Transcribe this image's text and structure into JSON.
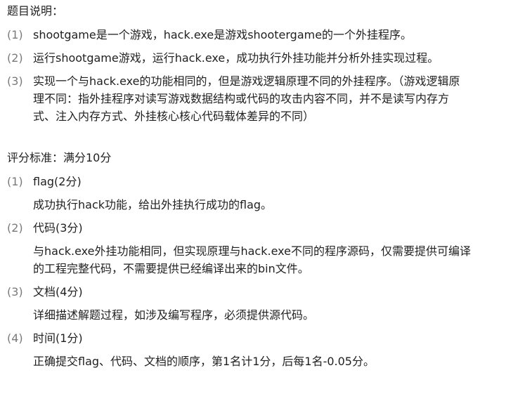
{
  "section1": {
    "heading": "题目说明：",
    "items": [
      {
        "num": "(1)",
        "lines": [
          "shootgame是一个游戏，hack.exe是游戏shootergame的一个外挂程序。"
        ]
      },
      {
        "num": "(2)",
        "lines": [
          "运行shootgame游戏，运行hack.exe，成功执行外挂功能并分析外挂实现过程。"
        ]
      },
      {
        "num": "(3)",
        "lines": [
          "实现一个与hack.exe的功能相同的，但是游戏逻辑原理不同的外挂程序。（游戏逻辑原",
          "理不同：指外挂程序对读写游戏数据结构或代码的攻击内容不同，并不是读写内存方",
          "式、注入内存方式、外挂核心核心代码载体差异的不同）"
        ]
      }
    ]
  },
  "section2": {
    "heading": "评分标准：满分10分",
    "items": [
      {
        "num": "(1)",
        "title": "flag(2分)",
        "desc": [
          "成功执行hack功能，给出外挂执行成功的flag。"
        ]
      },
      {
        "num": "(2)",
        "title": "代码(3分)",
        "desc": [
          "与hack.exe外挂功能相同，但实现原理与hack.exe不同的程序源码，仅需要提供可编译",
          "的工程完整代码，不需要提供已经编译出来的bin文件。"
        ]
      },
      {
        "num": "(3)",
        "title": "文档(4分)",
        "desc": [
          "详细描述解题过程，如涉及编写程序，必须提供源代码。"
        ]
      },
      {
        "num": "(4)",
        "title": "时间(1分)",
        "desc": [
          "正确提交flag、代码、文档的顺序，第1名计1分，后每1名-0.05分。"
        ]
      }
    ]
  }
}
